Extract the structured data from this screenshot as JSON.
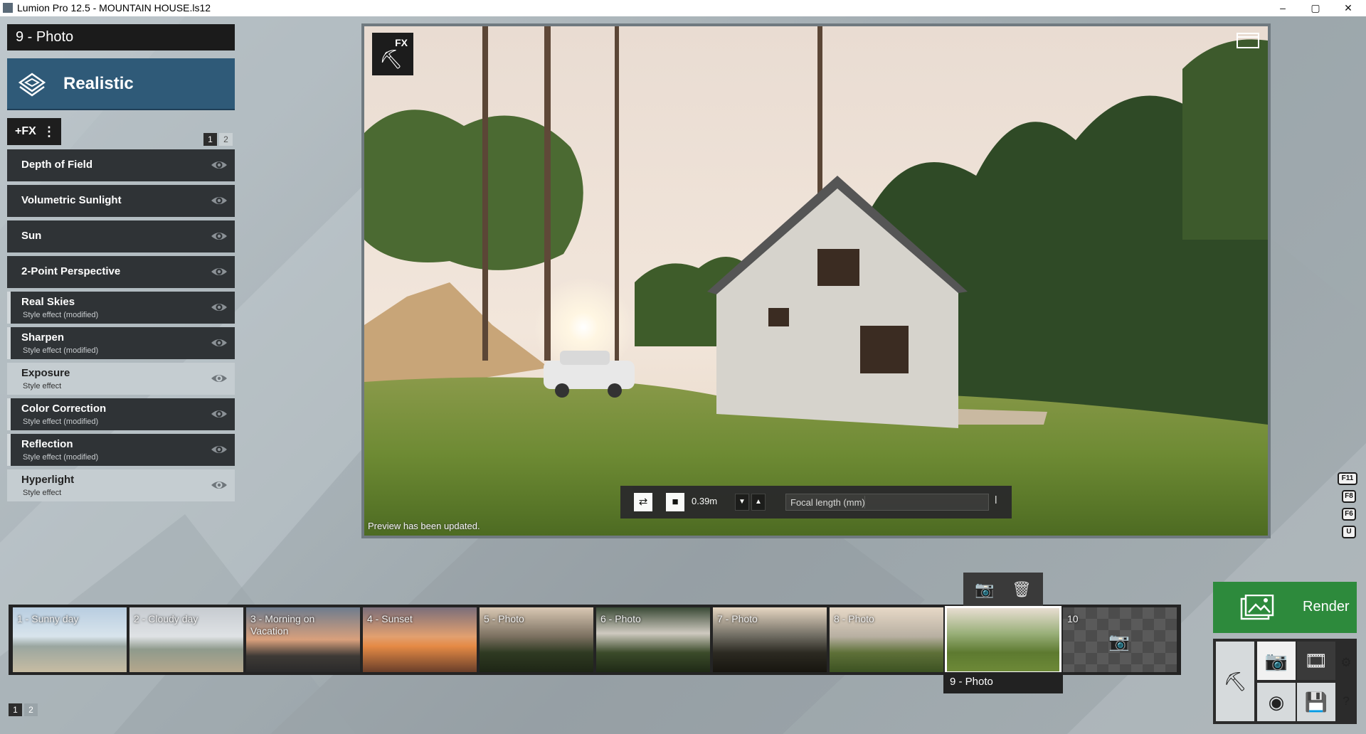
{
  "window": {
    "title": "Lumion Pro 12.5 - MOUNTAIN HOUSE.ls12",
    "minimize": "–",
    "maximize": "▢",
    "close": "✕"
  },
  "left_panel": {
    "photo_title": "9 - Photo",
    "preset_label": "Realistic",
    "fx_button": "+FX",
    "fx_menu": "⋮",
    "pages": [
      "1",
      "2"
    ],
    "effects": [
      {
        "name": "Depth of Field",
        "sub": ""
      },
      {
        "name": "Volumetric Sunlight",
        "sub": ""
      },
      {
        "name": "Sun",
        "sub": ""
      },
      {
        "name": "2-Point Perspective",
        "sub": ""
      },
      {
        "name": "Real Skies",
        "sub": "Style effect (modified)"
      },
      {
        "name": "Sharpen",
        "sub": "Style effect (modified)"
      },
      {
        "name": "Exposure",
        "sub": "Style effect"
      },
      {
        "name": "Color Correction",
        "sub": "Style effect (modified)"
      },
      {
        "name": "Reflection",
        "sub": "Style effect (modified)"
      },
      {
        "name": "Hyperlight",
        "sub": "Style effect"
      }
    ]
  },
  "viewport": {
    "fx_badge": "FX",
    "status": "Preview has been updated.",
    "camera_height": "0.39m",
    "focal_label": "Focal length (mm)"
  },
  "shortcut_keys": [
    "F11",
    "F8",
    "F6",
    "U"
  ],
  "photo_strip": {
    "thumbs": [
      {
        "label": "1 - Sunny day"
      },
      {
        "label": "2 - Cloudy day"
      },
      {
        "label": "3 - Morning on Vacation"
      },
      {
        "label": "4 - Sunset"
      },
      {
        "label": "5 - Photo"
      },
      {
        "label": "6 - Photo"
      },
      {
        "label": "7 - Photo"
      },
      {
        "label": "8 - Photo"
      },
      {
        "label": ""
      },
      {
        "label": "10"
      }
    ],
    "selected_caption": "9 - Photo",
    "pages": [
      "1",
      "2"
    ]
  },
  "render": {
    "label": "Render"
  },
  "colors": {
    "accent_blue": "#2f5a78",
    "render_green": "#2d8a3c",
    "panel_dark": "#2f3336"
  },
  "icons": {
    "preset": "layers-icon",
    "eye": "eye-icon",
    "camera": "camera-icon",
    "delete": "trash-icon",
    "movie": "film-icon",
    "settings": "gear-icon",
    "help": "help-icon"
  }
}
